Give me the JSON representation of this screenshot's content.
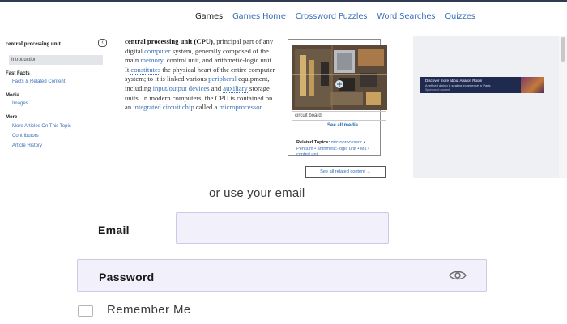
{
  "topnav": {
    "links": [
      "Games",
      "Games Home",
      "Crossword Puzzles",
      "Word Searches",
      "Quizzes"
    ]
  },
  "sidebar": {
    "title": "central processing unit",
    "collapse_icon": "chevron-left-icon",
    "active_item": "Introduction",
    "sections": [
      {
        "heading": "Fast Facts",
        "items": [
          "Facts & Related Content"
        ]
      },
      {
        "heading": "Media",
        "items": [
          "Images"
        ]
      },
      {
        "heading": "More",
        "items": [
          "More Articles On This Topic",
          "Contributors",
          "Article History"
        ]
      }
    ]
  },
  "article": {
    "lead": "central processing unit (CPU)",
    "t1": ", principal part of any digital ",
    "l1": "computer",
    "t2": " system, generally composed of the main ",
    "l2": "memory",
    "t3": ", control unit, and arithmetic-logic unit. It ",
    "l3": "constitutes",
    "t4": " the physical heart of the entire computer system; to it is linked various ",
    "l4": "peripheral",
    "t5": " equipment, including ",
    "l5": "input/output devices",
    "t6": " and ",
    "l6": "auxiliary",
    "t7": " storage units. In modern computers, the CPU is contained on an ",
    "l7": "integrated circuit chip",
    "t8": " called a ",
    "l8": "microprocessor",
    "t9": "."
  },
  "media": {
    "caption": "circuit board",
    "see_all": "See all media",
    "zoom_icon": "magnifier-plus-icon",
    "related_label": "Related Topics:",
    "related_links": "microprocessor • Pentium • arithmetic-logic unit • M1 • control unit",
    "see_all_related": "See all related content →"
  },
  "ad": {
    "line1": "Discover more about Abaron Room",
    "line2": "A refined dining & seating experience in Paris",
    "line3": "Sponsored content"
  },
  "login": {
    "or_email": "or use your email",
    "email_label": "Email",
    "password_label": "Password",
    "eye_icon": "eye-icon",
    "remember_label": "Remember Me"
  },
  "colors": {
    "link": "#3b6fb6",
    "input_bg": "#f2f0fb",
    "nav_border": "#2f3b52"
  }
}
